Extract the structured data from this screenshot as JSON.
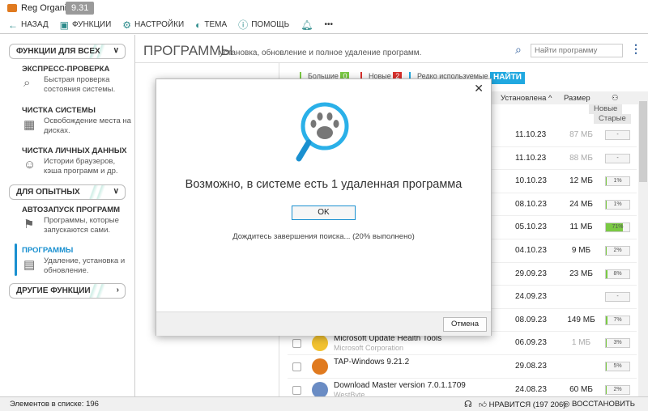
{
  "app": {
    "title": "Reg Organizer",
    "version": "9.31"
  },
  "toolbar": {
    "back": "НАЗАД",
    "functions": "ФУНКЦИИ",
    "settings": "НАСТРОЙКИ",
    "theme": "ТЕМА",
    "help": "ПОМОЩЬ",
    "more": "•••"
  },
  "sidebar": {
    "sections": [
      "ФУНКЦИИ ДЛЯ ВСЕХ",
      "ДЛЯ ОПЫТНЫХ",
      "ДРУГИЕ ФУНКЦИИ"
    ],
    "items": [
      {
        "title": "ЭКСПРЕСС-ПРОВЕРКА",
        "desc": "Быстрая проверка состояния системы."
      },
      {
        "title": "ЧИСТКА СИСТЕМЫ",
        "desc": "Освобождение места на дисках."
      },
      {
        "title": "ЧИСТКА ЛИЧНЫХ ДАННЫХ",
        "desc": "Истории браузеров, кэша программ и др."
      },
      {
        "title": "АВТОЗАПУСК ПРОГРАММ",
        "desc": "Программы, которые запускаются сами."
      },
      {
        "title": "ПРОГРАММЫ",
        "desc": "Удаление, установка и обновление."
      }
    ]
  },
  "main": {
    "title": "ПРОГРАММЫ",
    "subtitle": "установка, обновление и полное удаление программ.",
    "search_placeholder": "Найти программу",
    "filters": [
      {
        "label": "Большие",
        "count": "0",
        "color": "#7ac943"
      },
      {
        "label": "Новые",
        "count": "2",
        "color": "#d9302c"
      },
      {
        "label": "Редко используемые",
        "count": "",
        "color": "#20a8e0"
      }
    ],
    "find": "НАЙТИ",
    "columns": {
      "installed": "Установлена ^",
      "size": "Размер"
    },
    "groups": {
      "new": "Новые",
      "old": "Старые"
    },
    "rows": [
      {
        "date": "11.10.23",
        "size": "87 МБ",
        "gray": true,
        "usage": "-",
        "pct": 0
      },
      {
        "date": "11.10.23",
        "size": "88 МБ",
        "gray": true,
        "usage": "-",
        "pct": 0
      },
      {
        "date": "10.10.23",
        "size": "12 МБ",
        "usage": "1%",
        "pct": 1
      },
      {
        "date": "08.10.23",
        "size": "24 МБ",
        "usage": "1%",
        "pct": 1
      },
      {
        "date": "05.10.23",
        "size": "11 МБ",
        "usage": "71%",
        "pct": 71
      },
      {
        "date": "04.10.23",
        "size": "9 МБ",
        "usage": "2%",
        "pct": 2
      },
      {
        "date": "29.09.23",
        "size": "23 МБ",
        "usage": "8%",
        "pct": 8
      },
      {
        "date": "24.09.23",
        "size": "",
        "usage": "-",
        "pct": 0
      },
      {
        "date": "08.09.23",
        "size": "149 МБ",
        "usage": "7%",
        "pct": 7
      },
      {
        "name": "Microsoft Update Health Tools",
        "publisher": "Microsoft Corporation",
        "date": "06.09.23",
        "size": "1 МБ",
        "gray": true,
        "usage": "3%",
        "pct": 3
      },
      {
        "name": "TAP-Windows 9.21.2",
        "publisher": "",
        "date": "29.08.23",
        "size": "",
        "usage": "5%",
        "pct": 5
      },
      {
        "name": "Download Master version 7.0.1.1709",
        "publisher": "WestByte",
        "date": "24.08.23",
        "size": "60 МБ",
        "usage": "2%",
        "pct": 2
      }
    ]
  },
  "status": {
    "count": "Элементов в списке: 196",
    "like": "НРАВИТСЯ (197 206)",
    "restore": "ВОССТАНОВИТЬ"
  },
  "dialog": {
    "message": "Возможно, в системе есть 1 удаленная программа",
    "ok": "OK",
    "progress": "Дождитесь завершения поиска... (20% выполнено)",
    "cancel": "Отмена"
  }
}
